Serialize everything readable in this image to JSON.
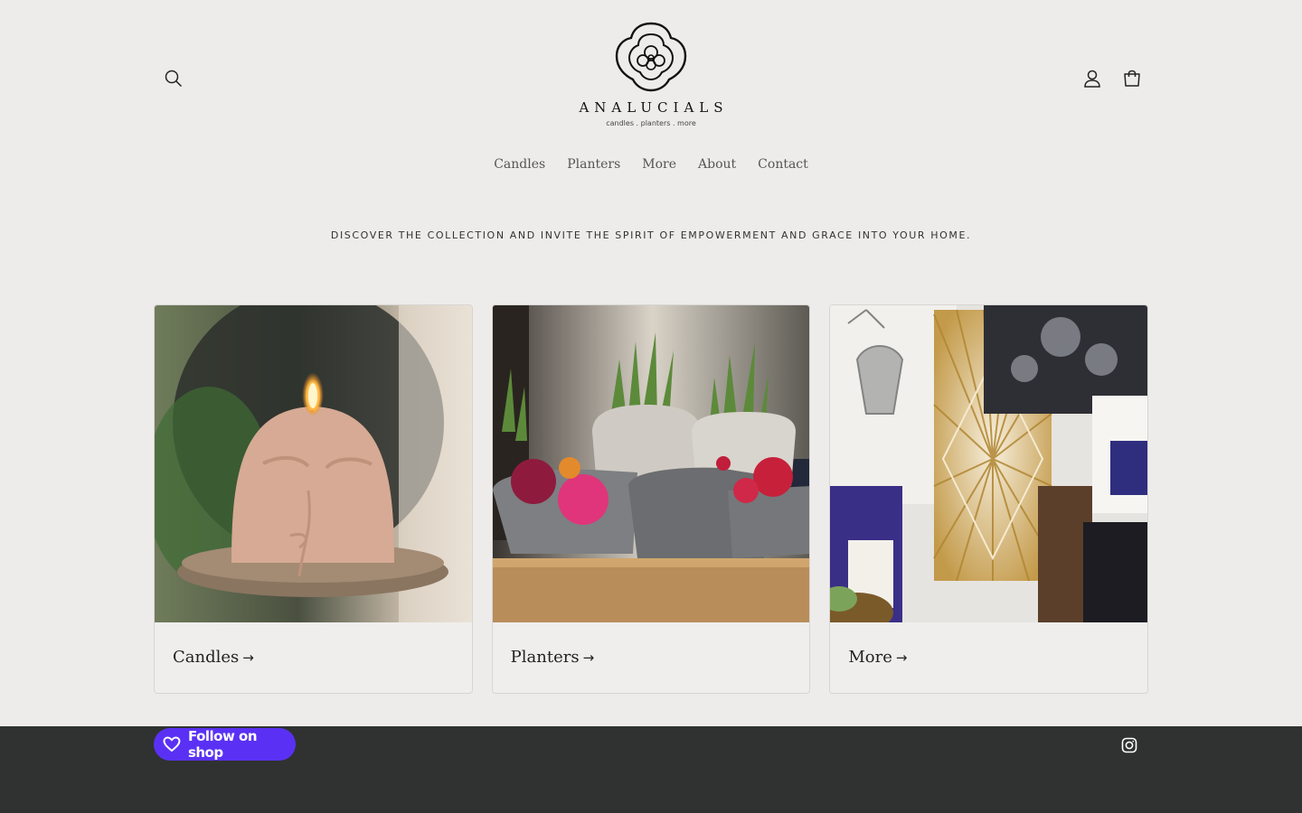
{
  "brand": {
    "name": "ANALUCIALS",
    "tagline": "candles . planters . more"
  },
  "header": {
    "icons": [
      "search-icon",
      "account-icon",
      "cart-icon"
    ]
  },
  "nav": {
    "items": [
      {
        "label": "Candles"
      },
      {
        "label": "Planters"
      },
      {
        "label": "More"
      },
      {
        "label": "About"
      },
      {
        "label": "Contact"
      }
    ]
  },
  "hero": {
    "tagline": "DISCOVER THE COLLECTION AND INVITE THE SPIRIT OF EMPOWERMENT AND GRACE INTO YOUR HOME."
  },
  "collections": [
    {
      "label": "Candles",
      "arrow": "→"
    },
    {
      "label": "Planters",
      "arrow": "→"
    },
    {
      "label": "More",
      "arrow": "→"
    }
  ],
  "footer": {
    "follow_label": "Follow on shop",
    "social_icon": "instagram-icon"
  },
  "colors": {
    "background": "#edecea",
    "footer": "#2f3230",
    "shop_purple": "#5a31f4"
  }
}
